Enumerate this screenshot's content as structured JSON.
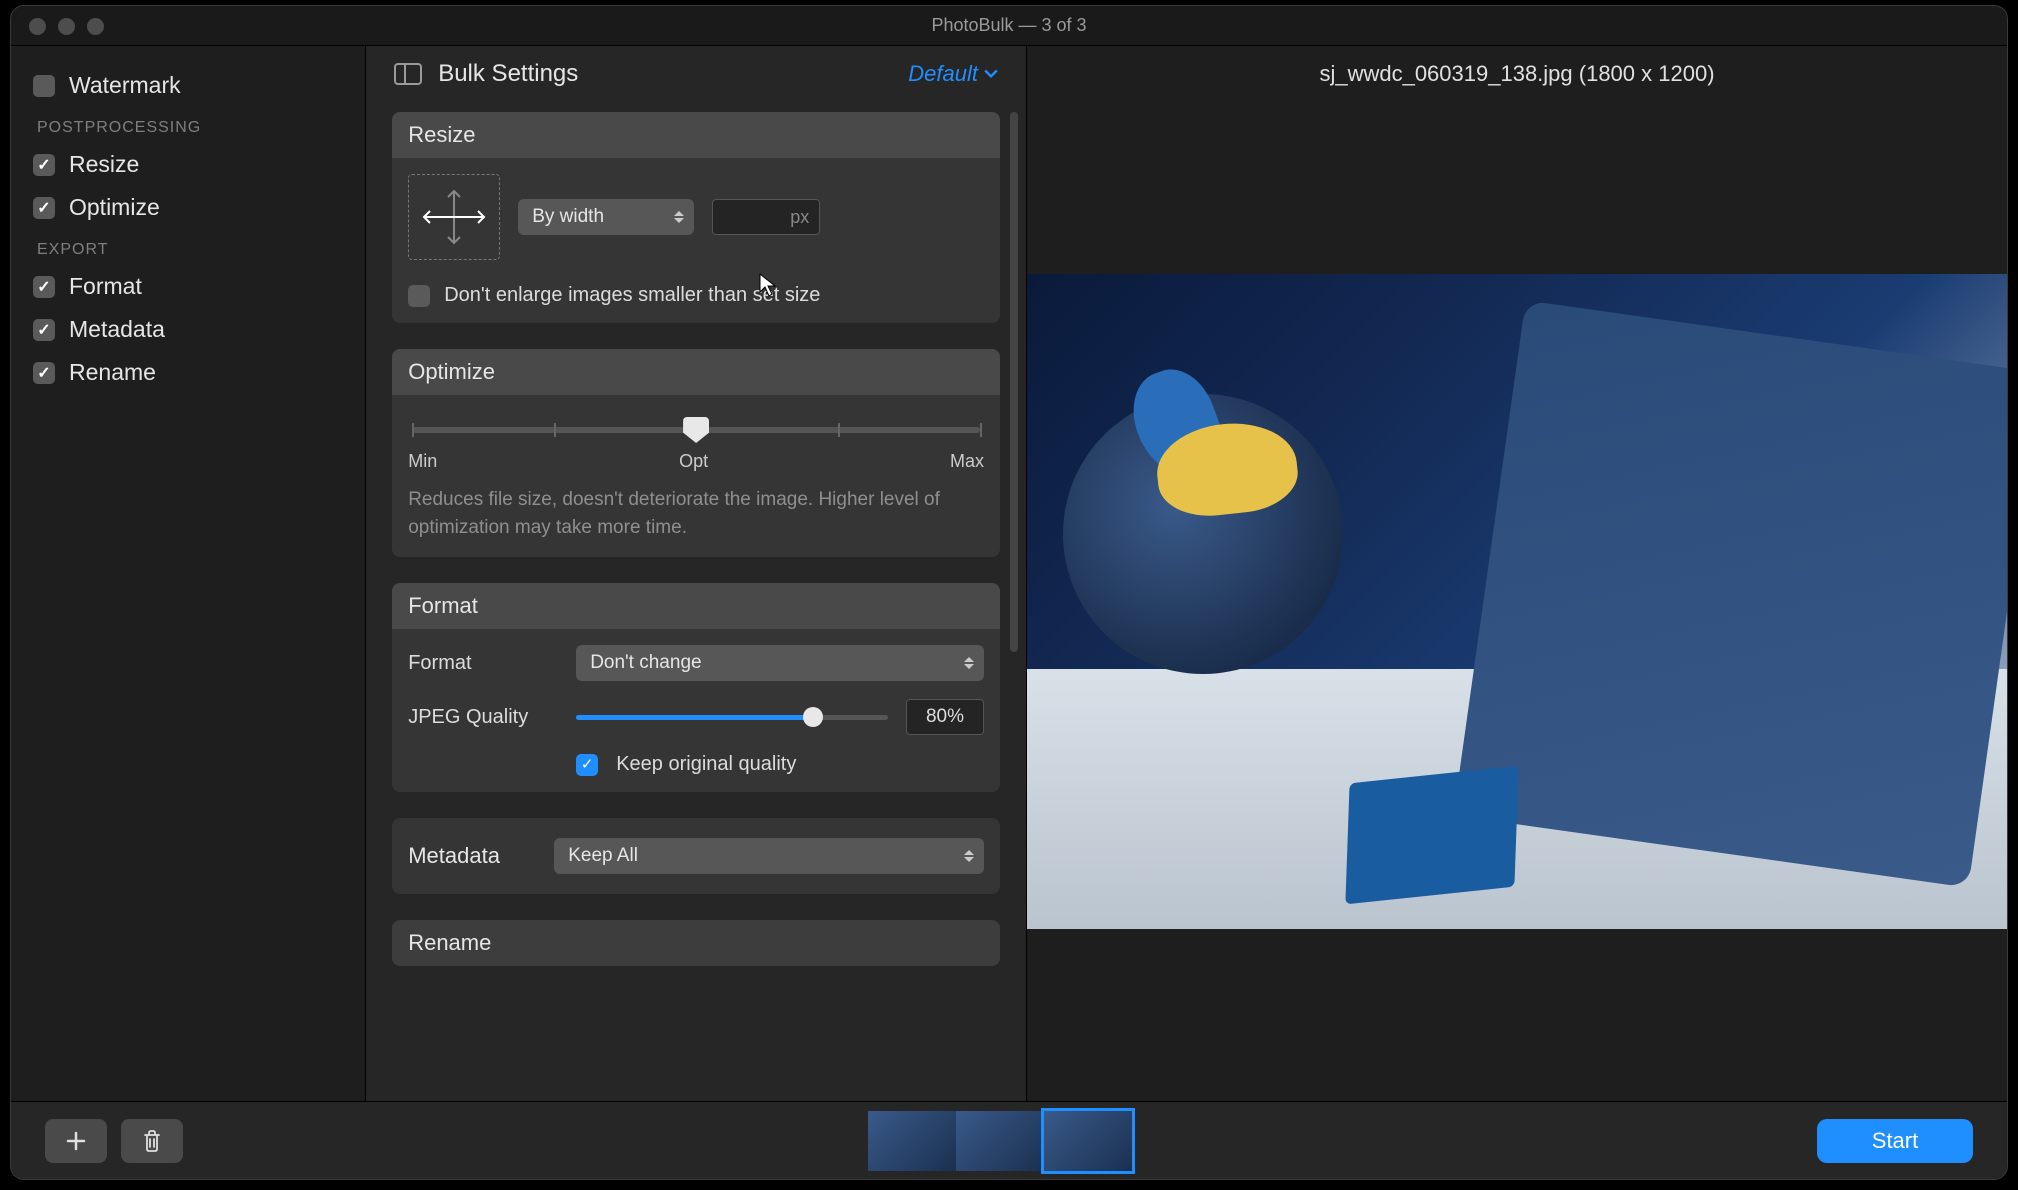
{
  "window": {
    "title": "PhotoBulk — 3 of 3"
  },
  "sidebar": {
    "watermark": {
      "label": "Watermark",
      "checked": false
    },
    "heading_post": "POSTPROCESSING",
    "resize": {
      "label": "Resize",
      "checked": true
    },
    "optimize": {
      "label": "Optimize",
      "checked": true
    },
    "heading_export": "EXPORT",
    "format": {
      "label": "Format",
      "checked": true
    },
    "metadata": {
      "label": "Metadata",
      "checked": true
    },
    "rename": {
      "label": "Rename",
      "checked": true
    }
  },
  "settings": {
    "title": "Bulk Settings",
    "preset": "Default",
    "resize": {
      "title": "Resize",
      "mode": "By width",
      "px_placeholder": "px",
      "no_enlarge": {
        "label": "Don't enlarge images smaller than set size",
        "checked": false
      }
    },
    "optimize": {
      "title": "Optimize",
      "min": "Min",
      "opt": "Opt",
      "max": "Max",
      "value_pct": 50,
      "desc": "Reduces file size, doesn't deteriorate the image. Higher level of optimization may take more time."
    },
    "format": {
      "title": "Format",
      "format_label": "Format",
      "format_value": "Don't change",
      "quality_label": "JPEG Quality",
      "quality_pct": 80,
      "quality_text": "80%",
      "keep_orig": {
        "label": "Keep original quality",
        "checked": true
      }
    },
    "metadata": {
      "title": "Metadata",
      "value": "Keep All"
    },
    "rename": {
      "title": "Rename"
    }
  },
  "preview": {
    "filename": "sj_wwdc_060319_138.jpg (1800 x 1200)"
  },
  "footer": {
    "start": "Start"
  }
}
